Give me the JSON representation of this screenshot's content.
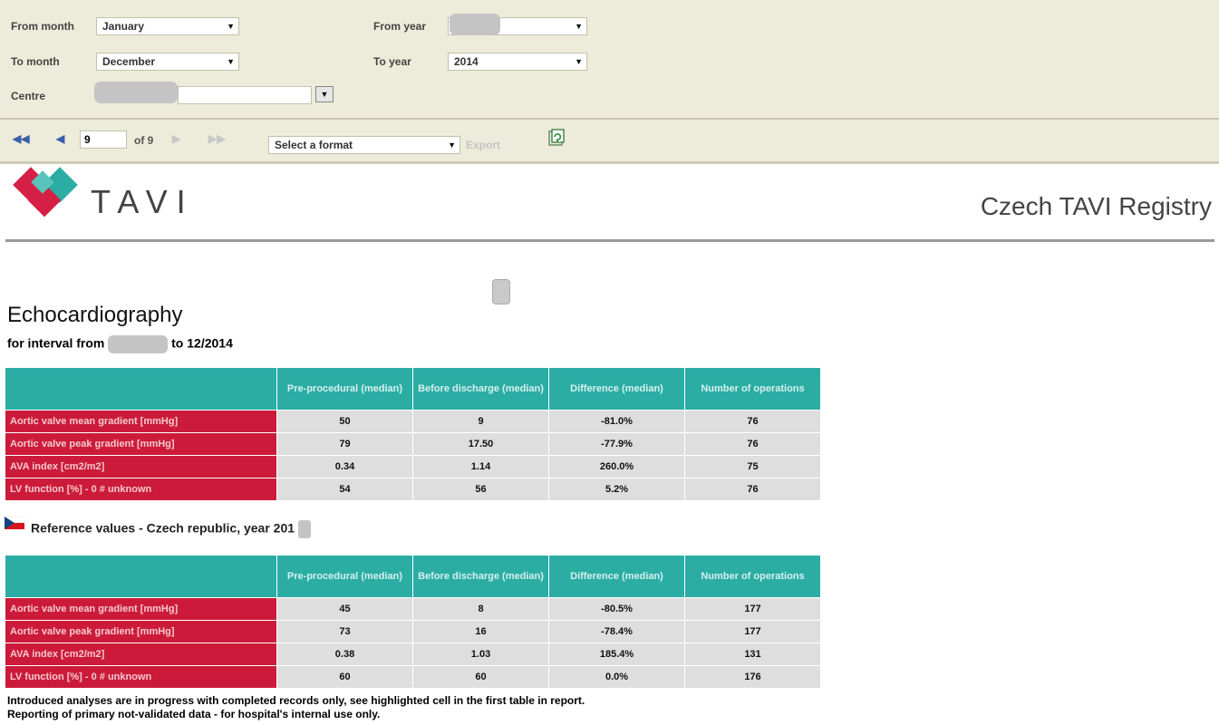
{
  "params": {
    "from_month_label": "From month",
    "from_month_value": "January",
    "to_month_label": "To month",
    "to_month_value": "December",
    "centre_label": "Centre",
    "from_year_label": "From year",
    "to_year_label": "To year",
    "to_year_value": "2014"
  },
  "toolbar": {
    "page_value": "9",
    "page_of": "of 9",
    "format_placeholder": "Select a format",
    "export_label": "Export"
  },
  "header": {
    "logo_text": "TAVI",
    "registry_title": "Czech TAVI Registry",
    "logo_colors": {
      "red": "#d61f45",
      "teal": "#2bada4"
    }
  },
  "report": {
    "title": "Echocardiography",
    "interval_prefix": "for interval from",
    "interval_suffix": "to 12/2014"
  },
  "table1": {
    "columns": [
      "Pre-procedural (median)",
      "Before discharge (median)",
      "Difference (median)",
      "Number of operations"
    ],
    "rows": [
      {
        "label": "Aortic valve mean gradient [mmHg]",
        "values": [
          "50",
          "9",
          "-81.0%",
          "76"
        ]
      },
      {
        "label": "Aortic valve peak gradient [mmHg]",
        "values": [
          "79",
          "17.50",
          "-77.9%",
          "76"
        ]
      },
      {
        "label": "AVA index [cm2/m2]",
        "values": [
          "0.34",
          "1.14",
          "260.0%",
          "75"
        ]
      },
      {
        "label": "LV function [%] - 0 # unknown",
        "values": [
          "54",
          "56",
          "5.2%",
          "76"
        ]
      }
    ]
  },
  "reference": {
    "title": "Reference values - Czech republic, year 201"
  },
  "table2": {
    "columns": [
      "Pre-procedural (median)",
      "Before discharge (median)",
      "Difference (median)",
      "Number of operations"
    ],
    "rows": [
      {
        "label": "Aortic valve mean gradient [mmHg]",
        "values": [
          "45",
          "8",
          "-80.5%",
          "177"
        ]
      },
      {
        "label": "Aortic valve peak gradient [mmHg]",
        "values": [
          "73",
          "16",
          "-78.4%",
          "177"
        ]
      },
      {
        "label": "AVA index [cm2/m2]",
        "values": [
          "0.38",
          "1.03",
          "185.4%",
          "131"
        ]
      },
      {
        "label": "LV function [%] - 0 # unknown",
        "values": [
          "60",
          "60",
          "0.0%",
          "176"
        ]
      }
    ]
  },
  "footnotes": {
    "line1": "Introduced analyses are in progress with completed records only, see highlighted cell in the first table in report.",
    "line2": "Reporting of primary not-validated data - for hospital's internal use only."
  }
}
